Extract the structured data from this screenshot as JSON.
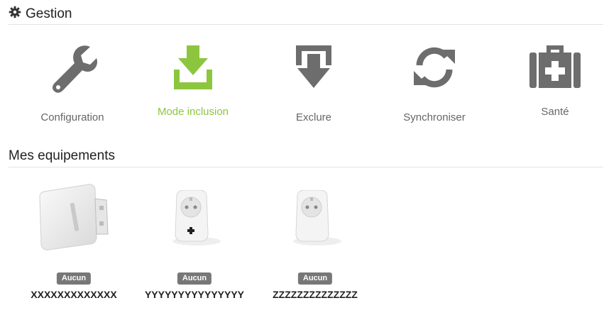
{
  "gestion": {
    "title": "Gestion",
    "actions": [
      {
        "label": "Configuration",
        "icon": "wrench-icon"
      },
      {
        "label": "Mode inclusion",
        "icon": "download-icon",
        "color": "#8cc63f"
      },
      {
        "label": "Exclure",
        "icon": "exclude-icon"
      },
      {
        "label": "Synchroniser",
        "icon": "sync-icon"
      },
      {
        "label": "Santé",
        "icon": "medical-kit-icon"
      }
    ],
    "icon_color": "#6d6d6d"
  },
  "equipments": {
    "title": "Mes equipements",
    "items": [
      {
        "badge": "Aucun",
        "name": "XXXXXXXXXXXXX",
        "icon": "usb-stick-icon"
      },
      {
        "badge": "Aucun",
        "name": "YYYYYYYYYYYYYYY",
        "icon": "smart-plug-icon"
      },
      {
        "badge": "Aucun",
        "name": "ZZZZZZZZZZZZZZ",
        "icon": "smart-plug-icon"
      }
    ]
  }
}
